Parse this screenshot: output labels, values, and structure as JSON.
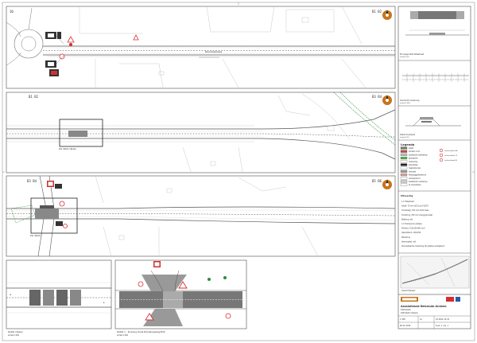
{
  "sheet": {
    "panels": {
      "p1": {
        "left_id": "10",
        "right_id": "B1 B2"
      },
      "p2": {
        "left_id": "B1 B2",
        "right_id": "B3 B4",
        "detail_label": "Zie detail rijbaan"
      },
      "p3": {
        "left_id": "B3 B4",
        "right_id": "B5 B6",
        "detail_label": "Zie detail 1"
      },
      "p4": {
        "caption": "Detail rijbaan",
        "scale": "schaal 1:200"
      },
      "p5": {
        "caption": "Detail 1 - Kruising Oude Rhedenseweg/Holt",
        "scale": "schaal 1:200"
      }
    },
    "side_panel": {
      "profile_caption": "Principeprofiel fietsstraat",
      "profile_scale": "schaal 1:50",
      "section_caption": "Overzicht markering",
      "section_scale": "schaal 1:500",
      "detail_caption": "Detail drempels",
      "detail_scale": "schaal 1:20",
      "legend_title": "Legenda",
      "legend_items": [
        "asfalt",
        "klinkers rood",
        "bestaande bestrating",
        "gras/groen",
        "markering",
        "stopstreep",
        "haaientanden",
        "drempel",
        "fietssuggestiestrook",
        "verkeersbord",
        "bestaande markering",
        "te verwijderen"
      ],
      "legend_signs": [
        "verkeersbord B6",
        "verkeersbord C1",
        "verkeersbord J8"
      ],
      "notes_title": "Uitvoering",
      "notes": [
        "1.1 Fietsstraat",
        "Asfalt: 70 mm AC16 surf 50/70",
        "Onderlaag: 130 mm AC22 base",
        "Fundering: 250 mm menggranulaat",
        "Belijning: wit",
        "1.2 Drempel en plateau",
        "Klinkers: 210x105x80 rood",
        "Opsluitband: 100x250",
        "Markering",
        "thermoplast, wit",
        "Alle bestaande markering ter plaatse verwijderen"
      ],
      "keymap_caption": "Overzichtskaart"
    },
    "title_block": {
      "title": "Aansluitende fietsroute Arnhem",
      "subtitle": "Fietsstraat",
      "drawing_type": "Definitief ontwerp",
      "drawing_number": "18-0012-VO-01",
      "scale": "1:500",
      "size": "A1",
      "date": "08-02-2019",
      "sheet": "blad 1 van 1"
    },
    "colors": {
      "line": "#333333",
      "road": "#555555",
      "grass": "#2e8b3d",
      "accent": "#d32f2f",
      "sign_orange": "#c8741a",
      "paving": "#8a8a8a"
    }
  }
}
